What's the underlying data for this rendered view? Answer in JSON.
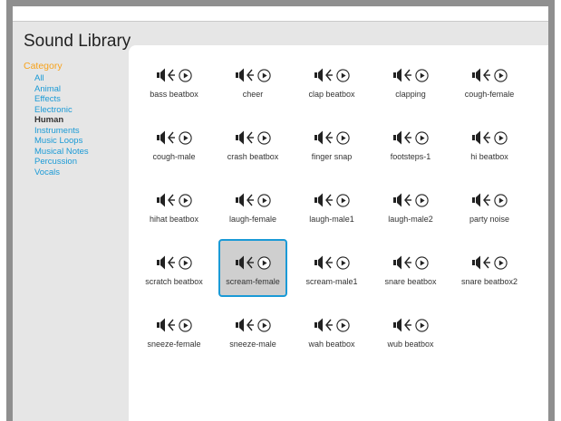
{
  "title": "Sound Library",
  "sidebar": {
    "heading": "Category",
    "items": [
      {
        "label": "All"
      },
      {
        "label": "Animal"
      },
      {
        "label": "Effects"
      },
      {
        "label": "Electronic"
      },
      {
        "label": "Human"
      },
      {
        "label": "Instruments"
      },
      {
        "label": "Music Loops"
      },
      {
        "label": "Musical Notes"
      },
      {
        "label": "Percussion"
      },
      {
        "label": "Vocals"
      }
    ],
    "selected": "Human"
  },
  "sounds": [
    {
      "label": "bass beatbox"
    },
    {
      "label": "cheer"
    },
    {
      "label": "clap beatbox"
    },
    {
      "label": "clapping"
    },
    {
      "label": "cough-female"
    },
    {
      "label": "cough-male"
    },
    {
      "label": "crash beatbox"
    },
    {
      "label": "finger snap"
    },
    {
      "label": "footsteps-1"
    },
    {
      "label": "hi beatbox"
    },
    {
      "label": "hihat beatbox"
    },
    {
      "label": "laugh-female"
    },
    {
      "label": "laugh-male1"
    },
    {
      "label": "laugh-male2"
    },
    {
      "label": "party noise"
    },
    {
      "label": "scratch beatbox"
    },
    {
      "label": "scream-female"
    },
    {
      "label": "scream-male1"
    },
    {
      "label": "snare beatbox"
    },
    {
      "label": "snare beatbox2"
    },
    {
      "label": "sneeze-female"
    },
    {
      "label": "sneeze-male"
    },
    {
      "label": "wah beatbox"
    },
    {
      "label": "wub beatbox"
    }
  ],
  "selected_sound": "scream-female",
  "icons": {
    "sound": "speaker-icon",
    "play": "play-icon"
  },
  "colors": {
    "link": "#1a9ad6",
    "heading": "#f7a21b",
    "selected_border": "#1a9ad6"
  }
}
